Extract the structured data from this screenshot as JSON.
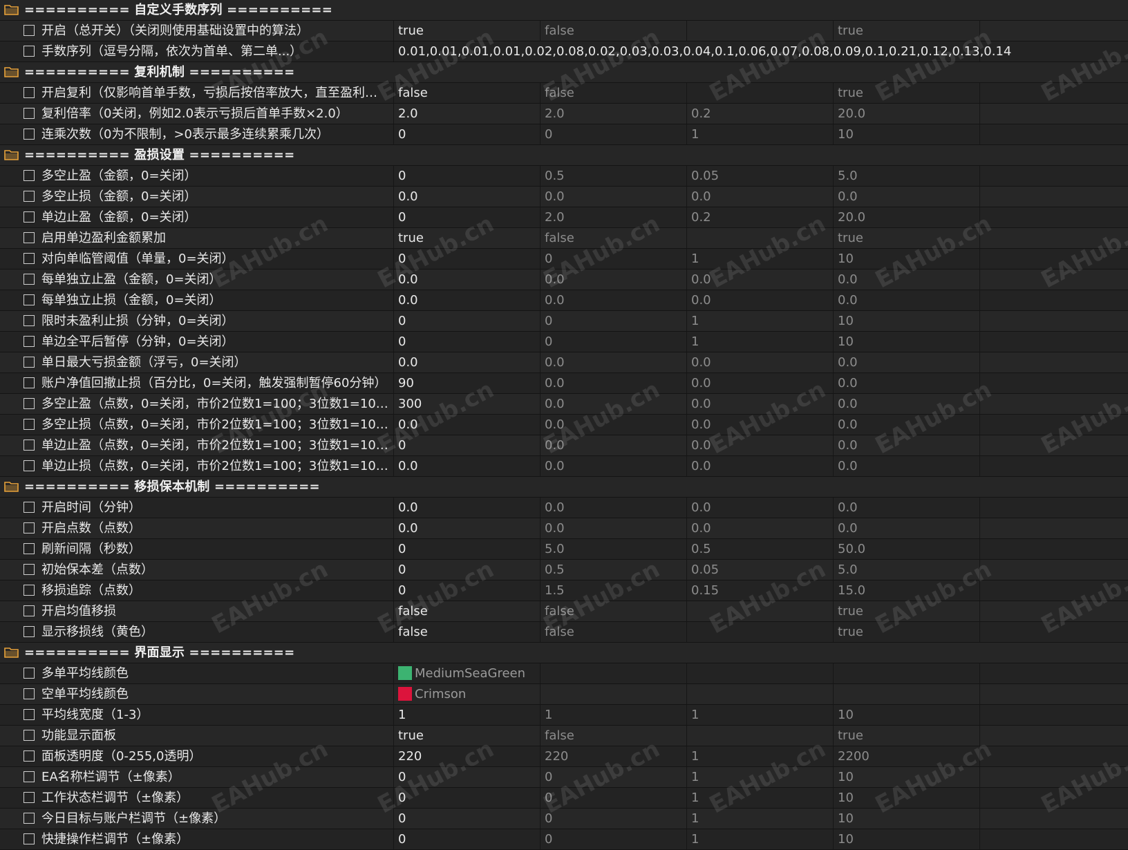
{
  "groups": [
    {
      "title": "========== 自定义手数序列 ==========",
      "params": [
        {
          "label": "开启（总开关）（关闭则使用基础设置中的算法）",
          "value": "true",
          "start": "false",
          "step": "",
          "stop": "true"
        },
        {
          "label": "手数序列（逗号分隔，依次为首单、第二单...）",
          "value": "0.01,0.01,0.01,0.01,0.02,0.08,0.02,0.03,0.03,0.04,0.1,0.06,0.07,0.08,0.09,0.1,0.21,0.12,0.13,0.14",
          "wide": true
        }
      ]
    },
    {
      "title": "========== 复利机制 ==========",
      "params": [
        {
          "label": "开启复利（仅影响首单手数，亏损后按倍率放大，直至盈利后...",
          "value": "false",
          "start": "false",
          "step": "",
          "stop": "true"
        },
        {
          "label": "复利倍率（0关闭，例如2.0表示亏损后首单手数×2.0）",
          "value": "2.0",
          "start": "2.0",
          "step": "0.2",
          "stop": "20.0"
        },
        {
          "label": "连乘次数（0为不限制，>0表示最多连续累乘几次）",
          "value": "0",
          "start": "0",
          "step": "1",
          "stop": "10"
        }
      ]
    },
    {
      "title": "========== 盈损设置 ==========",
      "params": [
        {
          "label": "多空止盈（金额，0=关闭）",
          "value": "0",
          "start": "0.5",
          "step": "0.05",
          "stop": "5.0"
        },
        {
          "label": "多空止损（金额，0=关闭）",
          "value": "0.0",
          "start": "0.0",
          "step": "0.0",
          "stop": "0.0"
        },
        {
          "label": "单边止盈（金额，0=关闭）",
          "value": "0",
          "start": "2.0",
          "step": "0.2",
          "stop": "20.0"
        },
        {
          "label": "启用单边盈利金额累加",
          "value": "true",
          "start": "false",
          "step": "",
          "stop": "true"
        },
        {
          "label": "对向单临管阈值（单量，0=关闭）",
          "value": "0",
          "start": "0",
          "step": "1",
          "stop": "10"
        },
        {
          "label": "每单独立止盈（金额，0=关闭）",
          "value": "0.0",
          "start": "0.0",
          "step": "0.0",
          "stop": "0.0"
        },
        {
          "label": "每单独立止损（金额，0=关闭）",
          "value": "0.0",
          "start": "0.0",
          "step": "0.0",
          "stop": "0.0"
        },
        {
          "label": "限时未盈利止损（分钟，0=关闭）",
          "value": "0",
          "start": "0",
          "step": "1",
          "stop": "10"
        },
        {
          "label": "单边全平后暂停（分钟，0=关闭）",
          "value": "0",
          "start": "0",
          "step": "1",
          "stop": "10"
        },
        {
          "label": "单日最大亏损金额（浮亏，0=关闭）",
          "value": "0.0",
          "start": "0.0",
          "step": "0.0",
          "stop": "0.0"
        },
        {
          "label": "账户净值回撤止损（百分比，0=关闭，触发强制暂停60分钟）",
          "value": "90",
          "start": "0.0",
          "step": "0.0",
          "stop": "0.0"
        },
        {
          "label": "多空止盈（点数，0=关闭，市价2位数1=100；3位数1=100...",
          "value": "300",
          "start": "0.0",
          "step": "0.0",
          "stop": "0.0"
        },
        {
          "label": "多空止损（点数，0=关闭，市价2位数1=100；3位数1=100...",
          "value": "0.0",
          "start": "0.0",
          "step": "0.0",
          "stop": "0.0"
        },
        {
          "label": "单边止盈（点数，0=关闭，市价2位数1=100；3位数1=100...",
          "value": "0",
          "start": "0.0",
          "step": "0.0",
          "stop": "0.0"
        },
        {
          "label": "单边止损（点数，0=关闭，市价2位数1=100；3位数1=100...",
          "value": "0.0",
          "start": "0.0",
          "step": "0.0",
          "stop": "0.0"
        }
      ]
    },
    {
      "title": "========== 移损保本机制 ==========",
      "params": [
        {
          "label": "开启时间（分钟）",
          "value": "0.0",
          "start": "0.0",
          "step": "0.0",
          "stop": "0.0"
        },
        {
          "label": "开启点数（点数）",
          "value": "0.0",
          "start": "0.0",
          "step": "0.0",
          "stop": "0.0"
        },
        {
          "label": "刷新间隔（秒数）",
          "value": "0",
          "start": "5.0",
          "step": "0.5",
          "stop": "50.0"
        },
        {
          "label": "初始保本差（点数）",
          "value": "0",
          "start": "0.5",
          "step": "0.05",
          "stop": "5.0"
        },
        {
          "label": "移损追踪（点数）",
          "value": "0",
          "start": "1.5",
          "step": "0.15",
          "stop": "15.0"
        },
        {
          "label": "开启均值移损",
          "value": "false",
          "start": "false",
          "step": "",
          "stop": "true"
        },
        {
          "label": "显示移损线（黄色）",
          "value": "false",
          "start": "false",
          "step": "",
          "stop": "true"
        }
      ]
    },
    {
      "title": "========== 界面显示 ==========",
      "params": [
        {
          "label": "多单平均线颜色",
          "value": "MediumSeaGreen",
          "color": "#3cb371",
          "start": "",
          "step": "",
          "stop": ""
        },
        {
          "label": "空单平均线颜色",
          "value": "Crimson",
          "color": "#dc143c",
          "start": "",
          "step": "",
          "stop": ""
        },
        {
          "label": "平均线宽度（1-3）",
          "value": "1",
          "start": "1",
          "step": "1",
          "stop": "10"
        },
        {
          "label": "功能显示面板",
          "value": "true",
          "start": "false",
          "step": "",
          "stop": "true"
        },
        {
          "label": "面板透明度（0-255,0透明）",
          "value": "220",
          "start": "220",
          "step": "1",
          "stop": "2200"
        },
        {
          "label": "EA名称栏调节（±像素）",
          "value": "0",
          "start": "0",
          "step": "1",
          "stop": "10"
        },
        {
          "label": "工作状态栏调节（±像素）",
          "value": "0",
          "start": "0",
          "step": "1",
          "stop": "10"
        },
        {
          "label": "今日目标与账户栏调节（±像素）",
          "value": "0",
          "start": "0",
          "step": "1",
          "stop": "10"
        },
        {
          "label": "快捷操作栏调节（±像素）",
          "value": "0",
          "start": "0",
          "step": "1",
          "stop": "10"
        }
      ]
    }
  ],
  "watermark": "EAHub.cn",
  "colors": {
    "folder": "#e8a23a",
    "background": "#1f1f1f"
  }
}
